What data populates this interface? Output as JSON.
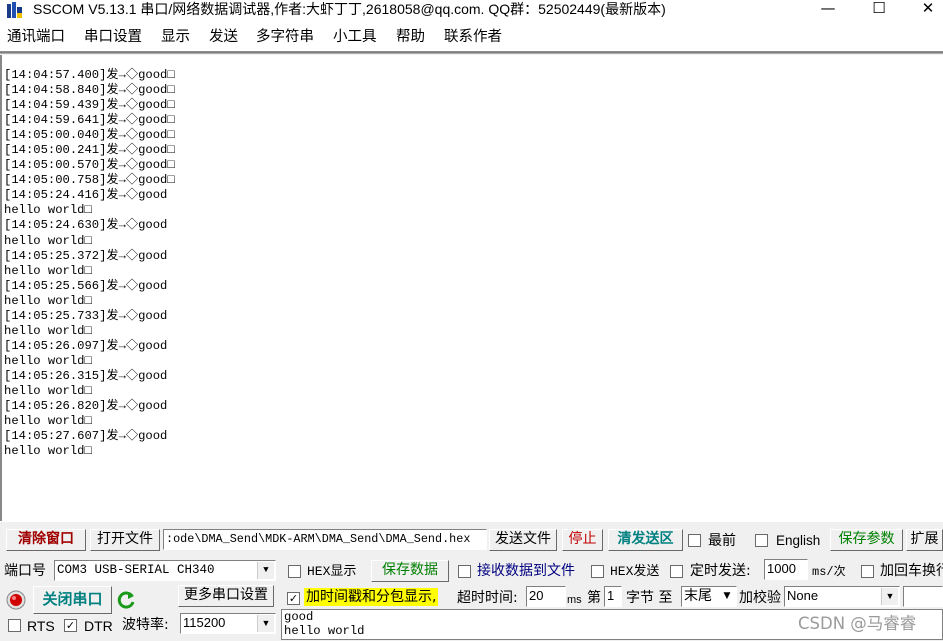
{
  "window": {
    "title": "SSCOM V5.13.1 串口/网络数据调试器,作者:大虾丁丁,2618058@qq.com. QQ群：52502449(最新版本)",
    "minimize_glyph": "—",
    "maximize_glyph": "☐",
    "close_glyph": "✕"
  },
  "menu": [
    "通讯端口",
    "串口设置",
    "显示",
    "发送",
    "多字符串",
    "小工具",
    "帮助",
    "联系作者"
  ],
  "receive_log": [
    "[14:04:57.400]发→◇good□",
    "[14:04:58.840]发→◇good□",
    "[14:04:59.439]发→◇good□",
    "[14:04:59.641]发→◇good□",
    "[14:05:00.040]发→◇good□",
    "[14:05:00.241]发→◇good□",
    "[14:05:00.570]发→◇good□",
    "[14:05:00.758]发→◇good□",
    "[14:05:24.416]发→◇good",
    "hello world□",
    "[14:05:24.630]发→◇good",
    "hello world□",
    "[14:05:25.372]发→◇good",
    "hello world□",
    "[14:05:25.566]发→◇good",
    "hello world□",
    "[14:05:25.733]发→◇good",
    "hello world□",
    "[14:05:26.097]发→◇good",
    "hello world□",
    "[14:05:26.315]发→◇good",
    "hello world□",
    "[14:05:26.820]发→◇good",
    "hello world□",
    "[14:05:27.607]发→◇good",
    "hello world□"
  ],
  "toolbar1": {
    "clear_window": "清除窗口",
    "open_file": "打开文件",
    "file_path": ":ode\\DMA_Send\\MDK-ARM\\DMA_Send\\DMA_Send.hex",
    "send_file": "发送文件",
    "stop": "停止",
    "clear_send": "清发送区",
    "topmost_label": "最前",
    "topmost_checked": false,
    "english_label": "English",
    "english_checked": false,
    "save_params": "保存参数",
    "expand": "扩展"
  },
  "port": {
    "port_label": "端口号",
    "port_value": "COM3 USB-SERIAL CH340",
    "close_port": "关闭串口",
    "more_settings": "更多串口设置",
    "rts_label": "RTS",
    "rts_checked": false,
    "dtr_label": "DTR",
    "dtr_checked": true,
    "baud_label": "波特率:",
    "baud_value": "115200"
  },
  "options": {
    "hex_display_label": "HEX显示",
    "hex_display_checked": false,
    "save_data": "保存数据",
    "recv_to_file_label": "接收数据到文件",
    "recv_to_file_checked": false,
    "timestamp_label": "加时间戳和分包显示,",
    "timestamp_checked": true,
    "timeout_label": "超时时间:",
    "timeout_value": "20",
    "timeout_unit": "ms",
    "hex_send_label": "HEX发送",
    "hex_send_checked": false,
    "timed_send_label": "定时发送:",
    "timed_send_checked": false,
    "interval_value": "1000",
    "interval_unit": "ms/次",
    "add_crlf_label": "加回车换行",
    "add_crlf_checked": false,
    "byte_from_label": "第",
    "byte_from_value": "1",
    "byte_unit": "字节 至",
    "byte_to_value": "末尾",
    "checksum_label": "加校验",
    "checksum_value": "None"
  },
  "send_text": [
    "good",
    "hello world"
  ],
  "watermark": "CSDN @马睿睿",
  "colors": {
    "clear_red": "#a00000",
    "close_port_teal": "#008080",
    "green_text": "#008000",
    "blue_text": "#000080",
    "highlight_yellow": "#ffff00"
  }
}
